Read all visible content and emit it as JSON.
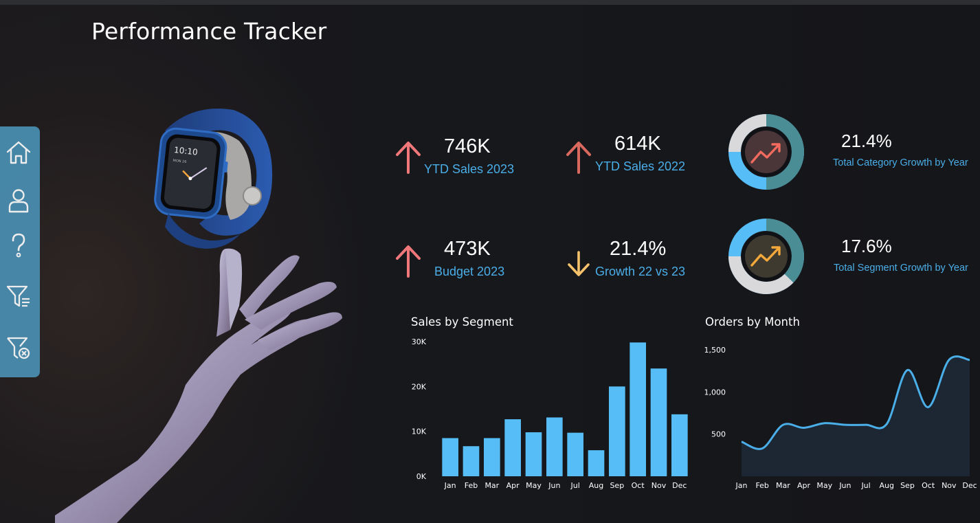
{
  "header": {
    "title": "Performance Tracker"
  },
  "nav": {
    "items": [
      {
        "icon": "home-icon"
      },
      {
        "icon": "user-icon"
      },
      {
        "icon": "help-icon"
      },
      {
        "icon": "filter-list-icon"
      },
      {
        "icon": "clear-filter-icon"
      }
    ]
  },
  "kpis": {
    "ytd_2023": {
      "value": "746K",
      "label": "YTD Sales 2023",
      "trend": "up",
      "color": "#f0787a"
    },
    "ytd_2022": {
      "value": "614K",
      "label": "YTD Sales 2022",
      "trend": "up",
      "color": "#d9685e"
    },
    "budget_2023": {
      "value": "473K",
      "label": "Budget 2023",
      "trend": "up",
      "color": "#f0787a"
    },
    "growth": {
      "value": "21.4%",
      "label": "Growth 22 vs 23",
      "trend": "down",
      "color": "#f5c26b"
    }
  },
  "rings": {
    "category": {
      "value": "21.4%",
      "label": "Total Category Growth by Year",
      "fraction": 0.5,
      "accent": "#f26b5e"
    },
    "segment": {
      "value": "17.6%",
      "label": "Total Segment Growth by Year",
      "fraction": 0.5,
      "accent": "#f5a93a"
    }
  },
  "colors": {
    "accent_blue": "#56bdf6",
    "label_blue": "#4aaee8",
    "nav_blue": "#4a8fb3"
  },
  "chart_data": [
    {
      "type": "bar",
      "title": "Sales by Segment",
      "categories": [
        "Jan",
        "Feb",
        "Mar",
        "Apr",
        "May",
        "Jun",
        "Jul",
        "Aug",
        "Sep",
        "Oct",
        "Nov",
        "Dec"
      ],
      "values": [
        8500,
        6700,
        8500,
        12700,
        9800,
        13100,
        9700,
        5800,
        20000,
        29800,
        24000,
        13800
      ],
      "ylim": [
        0,
        30000
      ],
      "yticks": [
        "0K",
        "10K",
        "20K",
        "30K"
      ],
      "ytick_values": [
        0,
        10000,
        20000,
        30000
      ]
    },
    {
      "type": "area",
      "title": "Orders by Month",
      "categories": [
        "Jan",
        "Feb",
        "Mar",
        "Apr",
        "May",
        "Jun",
        "Jul",
        "Aug",
        "Sep",
        "Oct",
        "Nov",
        "Dec"
      ],
      "values": [
        410,
        330,
        610,
        575,
        630,
        610,
        610,
        620,
        1260,
        820,
        1380,
        1380
      ],
      "ylim": [
        0,
        1500
      ],
      "yticks": [
        "500",
        "1,000",
        "1,500"
      ],
      "ytick_values": [
        500,
        1000,
        1500
      ]
    }
  ]
}
